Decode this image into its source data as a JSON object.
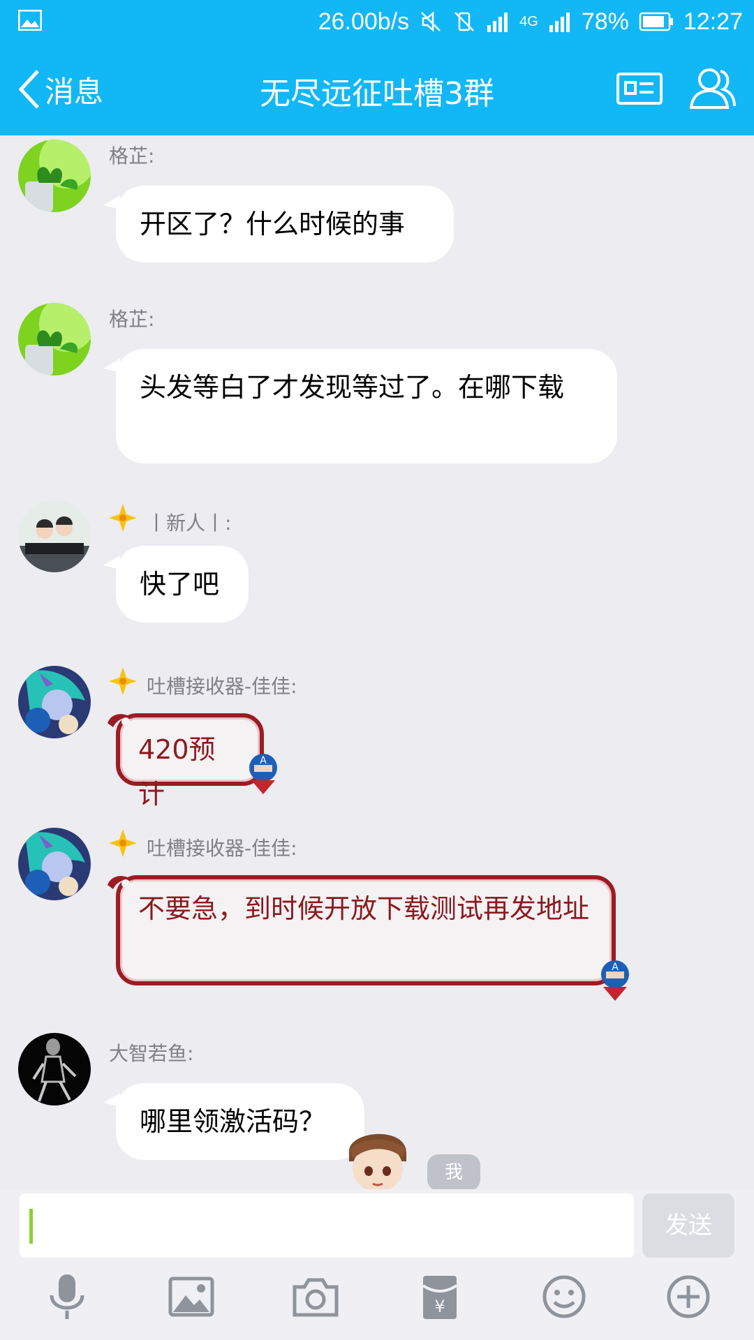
{
  "status_bar": {
    "speed": "26.00b/s",
    "network": "4G",
    "battery": "78%",
    "time": "12:27"
  },
  "header": {
    "back_label": "消息",
    "title": "无尽远征吐槽3群"
  },
  "messages": [
    {
      "sender": "格芷:",
      "text": "开区了？什么时候的事",
      "avatar": "plant-avatar"
    },
    {
      "sender": "格芷:",
      "text": "头发等白了才发现等过了。在哪下载",
      "avatar": "plant-avatar"
    },
    {
      "sender": "丨新人丨:",
      "text": "快了吧",
      "avatar": "kids-avatar",
      "badge": "star-badge-icon"
    },
    {
      "sender": "吐槽接收器-佳佳:",
      "text": "420预计",
      "avatar": "hero-avatar",
      "badge": "star-badge-icon",
      "style": "captain-bubble"
    },
    {
      "sender": "吐槽接收器-佳佳:",
      "text": "不要急，到时候开放下载测试再发地址",
      "avatar": "hero-avatar",
      "badge": "star-badge-icon",
      "style": "captain-bubble"
    },
    {
      "sender": "大智若鱼:",
      "text": "哪里领激活码？",
      "avatar": "xray-avatar"
    }
  ],
  "me_tag": "我",
  "composer": {
    "input_value": "",
    "send_label": "发送"
  },
  "toolbar": [
    "mic-icon",
    "image-icon",
    "camera-icon",
    "red-packet-icon",
    "emoji-icon",
    "plus-icon"
  ],
  "colors": {
    "brand": "#12b7f5",
    "chat_bg": "#ececf1",
    "fancy_border": "#9b1c24",
    "fancy_text": "#8b1a1f"
  }
}
